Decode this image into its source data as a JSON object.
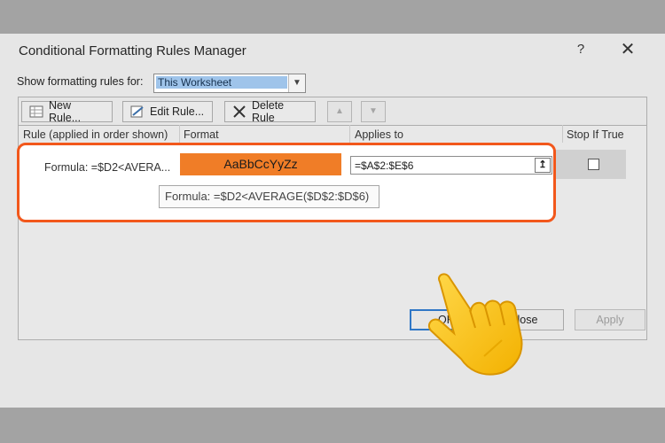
{
  "dialog": {
    "title": "Conditional Formatting Rules Manager",
    "help": "?",
    "close": "✕"
  },
  "show_for": {
    "label": "Show formatting rules for:",
    "value": "This Worksheet"
  },
  "toolbar": {
    "new_rule": "New Rule...",
    "edit_rule": "Edit Rule...",
    "delete_rule": "Delete Rule",
    "move_up": "▲",
    "move_down": "▼"
  },
  "columns": {
    "rule": "Rule (applied in order shown)",
    "format": "Format",
    "applies_to": "Applies to",
    "stop_if_true": "Stop If True"
  },
  "rules": [
    {
      "rule": "Formula: =$D2<AVERA...",
      "format_preview": "AaBbCcYyZz",
      "format_color": "#f07d27",
      "applies_to": "=$A$2:$E$6",
      "stop_if_true": false
    }
  ],
  "tooltip": "Formula: =$D2<AVERAGE($D$2:$D$6)",
  "buttons": {
    "ok": "OK",
    "close": "lose",
    "apply": "Apply"
  },
  "annotations": {
    "highlight_color": "#f2571b",
    "pointer": "hand-pointer-icon"
  },
  "icons": {
    "collapse": "↥"
  }
}
